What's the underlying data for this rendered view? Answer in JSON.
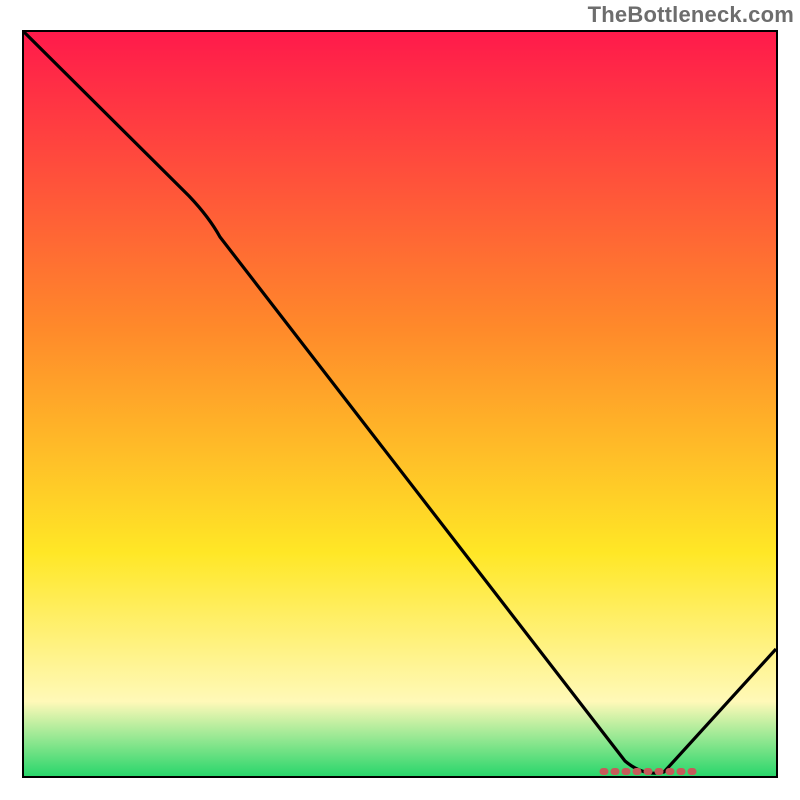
{
  "watermark": "TheBottleneck.com",
  "colors": {
    "top": "#ff1a4b",
    "mid1": "#ff8a2a",
    "mid2": "#ffe726",
    "mid3": "#fff9b8",
    "bottom": "#29d66b",
    "curve": "#000000",
    "marker": "#c65a5a"
  },
  "chart_data": {
    "type": "line",
    "title": "",
    "xlabel": "",
    "ylabel": "",
    "xlim": [
      0,
      100
    ],
    "ylim": [
      0,
      100
    ],
    "series": [
      {
        "name": "bottleneck-curve",
        "x": [
          0,
          22,
          26,
          80,
          84,
          100
        ],
        "values": [
          100,
          78,
          74,
          2,
          0,
          17
        ]
      }
    ],
    "optimum_marker": {
      "x_start": 77,
      "x_end": 89,
      "y": 0.6
    },
    "gradient_stops": [
      {
        "offset": 0.0,
        "color": "#ff1a4b"
      },
      {
        "offset": 0.4,
        "color": "#ff8a2a"
      },
      {
        "offset": 0.7,
        "color": "#ffe726"
      },
      {
        "offset": 0.9,
        "color": "#fff9b8"
      },
      {
        "offset": 1.0,
        "color": "#29d66b"
      }
    ]
  }
}
